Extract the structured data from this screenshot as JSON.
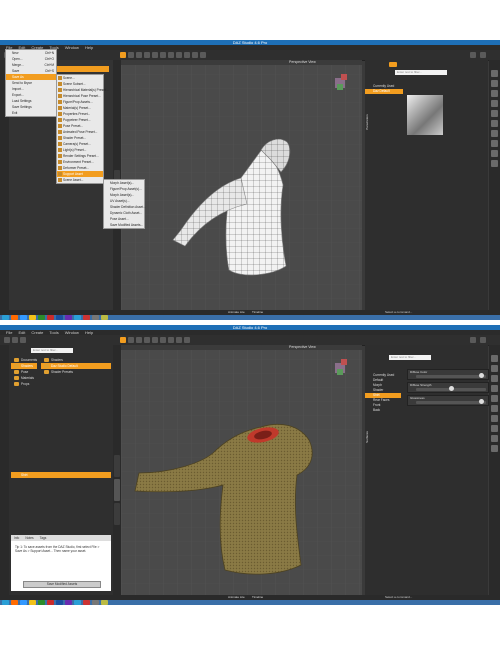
{
  "screen1": {
    "window_title": "DAZ Studio 4.6 Pro",
    "menubar": [
      "File",
      "Edit",
      "Create",
      "Tools",
      "Window",
      "Help"
    ],
    "file_menu": [
      {
        "label": "New",
        "shortcut": "Ctrl+N"
      },
      {
        "label": "Open...",
        "shortcut": "Ctrl+O"
      },
      {
        "label": "Merge...",
        "shortcut": "Ctrl+M"
      },
      {
        "label": "Save",
        "shortcut": "Ctrl+S"
      },
      {
        "label": "Save As",
        "shortcut": "",
        "highlighted": true
      },
      {
        "label": "Send to Bryce",
        "shortcut": ""
      },
      {
        "label": "Import...",
        "shortcut": ""
      },
      {
        "label": "Export...",
        "shortcut": ""
      },
      {
        "label": "Load Settings",
        "shortcut": ""
      },
      {
        "label": "Save Settings",
        "shortcut": ""
      },
      {
        "label": "Exit",
        "shortcut": ""
      }
    ],
    "save_as_submenu": [
      "Scene...",
      "Scene Subset...",
      "Hierarchical Material(s) Preset...",
      "Hierarchical Pose Preset...",
      "Figure/Prop Assets...",
      "Material(s) Preset...",
      "Properties Preset...",
      "Puppeteer Preset...",
      "Pose Preset...",
      "Animated Pose Preset...",
      "Shader Preset...",
      "Camera(s) Preset...",
      "Light(s) Preset...",
      "Render Settings Preset...",
      "Environment Preset...",
      "Deformer Preset...",
      "Support Asset",
      "Scene Asset..."
    ],
    "support_asset_submenu": [
      "Morph Asset(s)...",
      "Figure/Prop Asset(s)...",
      "Morph Asset(s)...",
      "UV Asset(s)...",
      "Shader Definition Asset...",
      "Dynamic Cloth Asset...",
      "Pose Asset...",
      "Save Modified Assets..."
    ],
    "viewport_label": "Perspective View",
    "right_panel": {
      "search_placeholder": "Enter text to filter...",
      "tab_label": "Parameters",
      "item_label": "Currently Used",
      "sub_item": "Daz Default"
    },
    "bottom_tabs": [
      "Animate Lite",
      "Timeline"
    ],
    "status": "Select a command..."
  },
  "screen2": {
    "window_title": "DAZ Studio 4.6 Pro",
    "menubar": [
      "File",
      "Edit",
      "Create",
      "Tools",
      "Window",
      "Help"
    ],
    "left_panel": {
      "search_placeholder": "Enter text to filter...",
      "folders": [
        "Documents",
        "Shaders",
        "Pose",
        "Materials",
        "Props"
      ],
      "selected_folder": "Shaders",
      "content_items": [
        "Shaders",
        "Daz Studio Default",
        "Shader Presets"
      ],
      "selected_item": "Shirt",
      "tabs": [
        "Info",
        "Notes",
        "Tags"
      ],
      "description": "Tip 1: To save assets from the DAZ Studio, first select File > Save As > Support Asset... Then name your asset.",
      "button_label": "Save Modified Assets"
    },
    "viewport_label": "Perspective View",
    "right_panel": {
      "search_placeholder": "Enter text to filter...",
      "tab_label": "Surfaces",
      "item_label": "Currently Used",
      "tree": [
        "Default",
        "Morph",
        "Shader",
        "Shirt",
        "Rear Faces",
        "Front",
        "Back"
      ],
      "selected_tree": "Shirt",
      "sliders": [
        {
          "label": "Diffuse Color",
          "value": 0.94
        },
        {
          "label": "Diffuse Strength",
          "value": 0.5
        },
        {
          "label": "Glossiness",
          "value": 0.94
        }
      ]
    },
    "bottom_tabs": [
      "Animate Lite",
      "Timeline"
    ],
    "status": "Select a command..."
  },
  "colors": {
    "accent": "#f29d1f",
    "titlebar": "#1e6fb6",
    "taskbar": "#3a6fa8",
    "ui_bg": "#333333",
    "viewport_bg": "#4a4a4a"
  }
}
